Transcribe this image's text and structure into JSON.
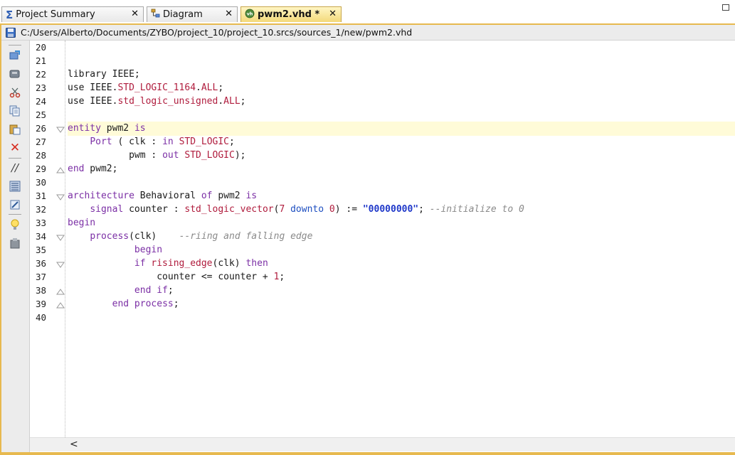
{
  "tabs": [
    {
      "label": "Project Summary",
      "icon": "sigma-icon",
      "close": "✕",
      "active": false
    },
    {
      "label": "Diagram",
      "icon": "diagram-icon",
      "close": "✕",
      "active": false
    },
    {
      "label": "pwm2.vhd *",
      "icon": "vhdl-file-icon",
      "close": "✕",
      "active": true
    }
  ],
  "editor": {
    "file_path": "C:/Users/Alberto/Documents/ZYBO/project_10/project_10.srcs/sources_1/new/pwm2.vhd"
  },
  "toolbar_icons": [
    "save-icon",
    "open-icon",
    "disk-icon",
    "cut-icon",
    "copy-icon",
    "paste-icon",
    "delete-icon",
    "comment-icon",
    "select-block-icon",
    "indent-icon",
    "bulb-icon",
    "template-icon"
  ],
  "line_numbers": [
    "20",
    "21",
    "22",
    "23",
    "24",
    "25",
    "26",
    "27",
    "28",
    "29",
    "30",
    "31",
    "32",
    "33",
    "34",
    "35",
    "36",
    "37",
    "38",
    "39",
    "40"
  ],
  "code": {
    "l22": {
      "a": "library IEEE;"
    },
    "l23": {
      "a": "use IEEE.",
      "b": "STD_LOGIC_1164",
      "c": ".",
      "d": "ALL",
      "e": ";"
    },
    "l24": {
      "a": "use IEEE.",
      "b": "std_logic_unsigned",
      "c": ".",
      "d": "ALL",
      "e": ";"
    },
    "l26": {
      "a": "entity",
      "b": " pwm2 ",
      "c": "is"
    },
    "l27": {
      "a": "    ",
      "b": "Port",
      "c": " ( clk : ",
      "d": "in",
      "e": " ",
      "f": "STD_LOGIC",
      "g": ";"
    },
    "l28": {
      "a": "           pwm : ",
      "b": "out",
      "c": " ",
      "d": "STD_LOGIC",
      "e": ");"
    },
    "l29": {
      "a": "end",
      "b": " pwm2;"
    },
    "l31": {
      "a": "architecture",
      "b": " Behavioral ",
      "c": "of",
      "d": " pwm2 ",
      "e": "is"
    },
    "l32": {
      "a": "    ",
      "b": "signal",
      "c": " counter : ",
      "d": "std_logic_vector",
      "e": "(",
      "f": "7",
      "g": " ",
      "h": "downto",
      "i": " ",
      "j": "0",
      "k": ") := ",
      "l": "\"00000000\"",
      "m": "; ",
      "n": "--initialize to 0"
    },
    "l33": {
      "a": "begin"
    },
    "l34": {
      "a": "    ",
      "b": "process",
      "c": "(clk)    ",
      "d": "--riing and falling edge"
    },
    "l35": {
      "a": "            ",
      "b": "begin"
    },
    "l36": {
      "a": "            ",
      "b": "if",
      "c": " ",
      "d": "rising_edge",
      "e": "(clk) ",
      "f": "then"
    },
    "l37": {
      "a": "                counter <= counter + ",
      "b": "1",
      "c": ";"
    },
    "l38": {
      "a": "            ",
      "b": "end if",
      "c": ";"
    },
    "l39": {
      "a": "        ",
      "b": "end process",
      "c": ";"
    }
  },
  "scrollbar": {
    "left_arrow": "<"
  }
}
